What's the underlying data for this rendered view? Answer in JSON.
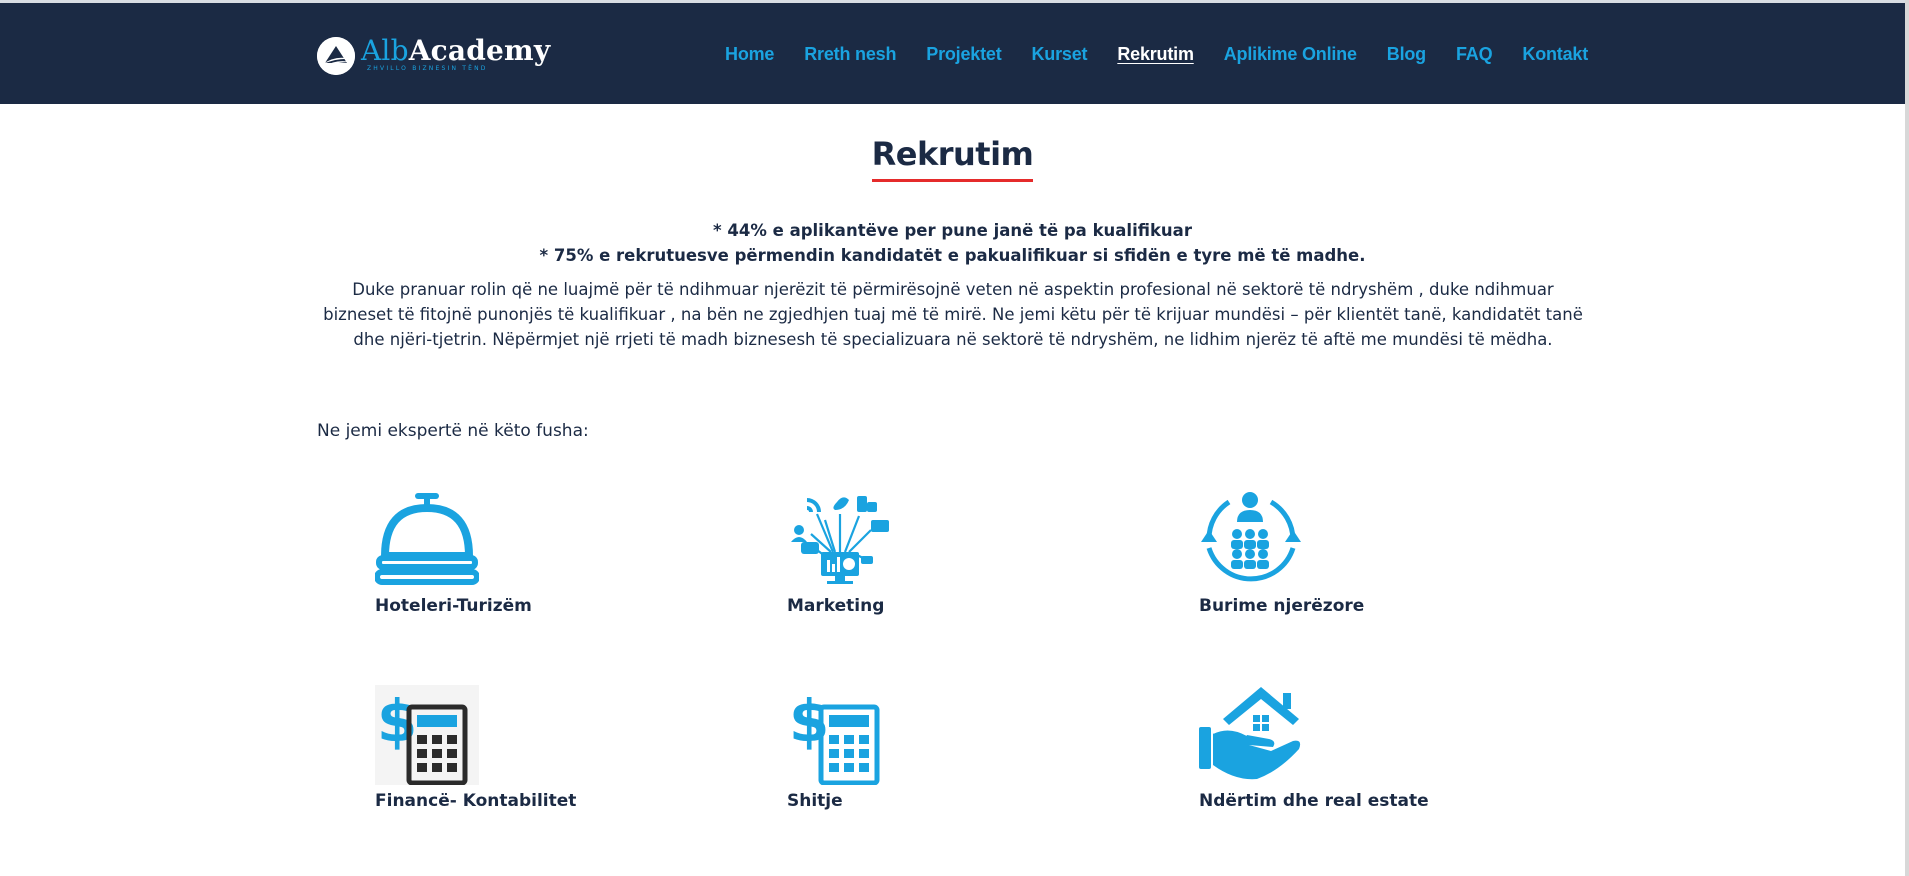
{
  "header": {
    "logo": {
      "part1": "Alb",
      "part2": "Academy",
      "tagline": "ZHVILLO BIZNESIN TËND"
    },
    "nav": [
      {
        "label": "Home",
        "active": false
      },
      {
        "label": "Rreth nesh",
        "active": false
      },
      {
        "label": "Projektet",
        "active": false
      },
      {
        "label": "Kurset",
        "active": false
      },
      {
        "label": "Rekrutim",
        "active": true
      },
      {
        "label": "Aplikime Online",
        "active": false
      },
      {
        "label": "Blog",
        "active": false
      },
      {
        "label": "FAQ",
        "active": false
      },
      {
        "label": "Kontakt",
        "active": false
      }
    ]
  },
  "main": {
    "title": "Rekrutim",
    "stats": [
      "* 44% e aplikantëve per pune janë të pa kualifikuar",
      "* 75% e rekrutuesve përmendin kandidatët e pakualifikuar si sfidën e tyre më të madhe."
    ],
    "intro": "Duke pranuar rolin që ne luajmë për të ndihmuar njerëzit të përmirësojnë veten në aspektin profesional në sektorë të ndryshëm , duke ndihmuar bizneset të fitojnë punonjës të kualifikuar , na bën ne zgjedhjen tuaj më të mirë. Ne jemi këtu për të krijuar mundësi – për klientët tanë, kandidatët tanë dhe njëri-tjetrin. Nëpërmjet një rrjeti të madh biznesesh të specializuara në sektorë të ndryshëm, ne lidhim njerëz të aftë me mundësi të mëdha.",
    "experts_heading": "Ne jemi ekspertë në këto fusha:",
    "fields": [
      {
        "label": "Hoteleri-Turizëm",
        "icon": "service-bell-icon"
      },
      {
        "label": "Marketing",
        "icon": "social-media-network-icon"
      },
      {
        "label": "Burime njerëzore",
        "icon": "human-resources-cycle-icon"
      },
      {
        "label": "Financë- Kontabilitet",
        "icon": "dollar-calculator-icon"
      },
      {
        "label": "Shitje",
        "icon": "dollar-calculator-icon"
      },
      {
        "label": "Ndërtim dhe real estate",
        "icon": "hand-house-icon"
      }
    ]
  },
  "colors": {
    "header_bg": "#1b2a44",
    "accent_blue": "#1aa3e0",
    "title_underline": "#e52b2b",
    "text_dark": "#1b2a44"
  }
}
